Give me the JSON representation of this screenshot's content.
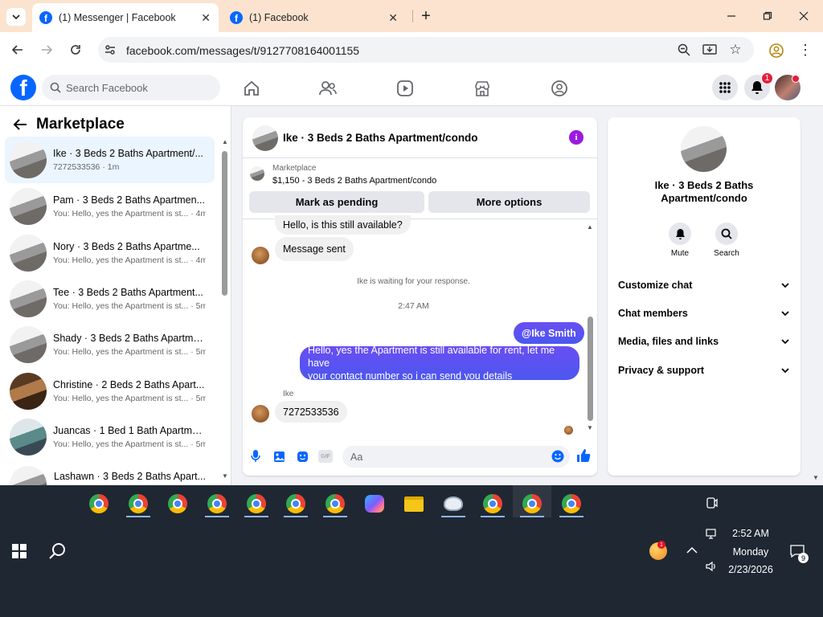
{
  "browser": {
    "tabs": [
      {
        "label": "(1) Messenger | Facebook"
      },
      {
        "label": "(1) Facebook"
      }
    ],
    "url": "facebook.com/messages/t/9127708164001155"
  },
  "fb": {
    "search_placeholder": "Search Facebook",
    "notif_count": "1"
  },
  "left": {
    "title": "Marketplace",
    "items": [
      {
        "title": "Ike · 3 Beds 2 Baths Apartment/...",
        "sub": "7272533536 · 1m"
      },
      {
        "title": "Pam · 3 Beds 2 Baths Apartmen...",
        "sub": "You: Hello, yes the Apartment is st... · 4m"
      },
      {
        "title": "Nory · 3 Beds 2 Baths Apartme...",
        "sub": "You: Hello, yes the Apartment is st... · 4m"
      },
      {
        "title": "Tee · 3 Beds 2 Baths Apartment...",
        "sub": "You: Hello, yes the Apartment is st... · 5m"
      },
      {
        "title": "Shady · 3 Beds 2 Baths Apartme...",
        "sub": "You: Hello, yes the Apartment is st... · 5m"
      },
      {
        "title": "Christine · 2 Beds 2 Baths Apart...",
        "sub": "You: Hello, yes the Apartment is st... · 5m"
      },
      {
        "title": "Juancas · 1 Bed 1 Bath Apartme...",
        "sub": "You: Hello, yes the Apartment is st... · 5m"
      },
      {
        "title": "Lashawn · 3 Beds 2 Baths Apart...",
        "sub": ""
      }
    ]
  },
  "chat": {
    "title": "Ike · 3 Beds 2 Baths Apartment/condo",
    "listing_label": "Marketplace",
    "listing_detail": "$1,150 - 3 Beds 2 Baths Apartment/condo",
    "btn_pending": "Mark as pending",
    "btn_more": "More options",
    "msg1": "Hello, is this still available?",
    "msg2": "Message sent",
    "waiting": "Ike is waiting for your response.",
    "time": "2:47 AM",
    "mention": "@Ike Smith",
    "out_msg_line1": "Hello, yes the Apartment is still available for rent, let me have",
    "out_msg_line2": "your contact number so i can send you details",
    "sender": "Ike",
    "in_msg": "7272533536",
    "input_placeholder": "Aa"
  },
  "info": {
    "name_line1": "Ike · 3 Beds 2 Baths",
    "name_line2": "Apartment/condo",
    "mute": "Mute",
    "search": "Search",
    "rows": [
      "Customize chat",
      "Chat members",
      "Media, files and links",
      "Privacy & support"
    ]
  },
  "taskbar": {
    "time": "2:52 AM",
    "day": "Monday",
    "date": "2/23/2026",
    "notif": "9"
  },
  "colors": {
    "fb_blue": "#0866ff",
    "accent_purple": "#5b4ff1",
    "bg": "#f0f2f5"
  }
}
